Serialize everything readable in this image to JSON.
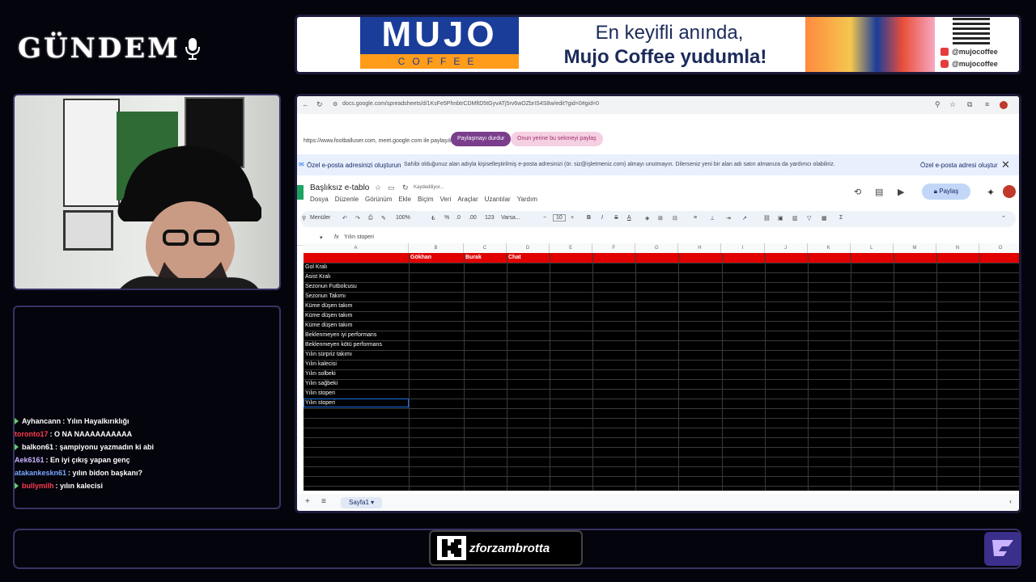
{
  "overlay": {
    "brand": "GÜNDEM",
    "channel_name": "zforzambrotta"
  },
  "ad": {
    "logo_word": "MUJO",
    "logo_sub": "COFFEE",
    "line1": "En keyifli anında,",
    "line2": "Mujo Coffee yudumla!",
    "social_facebook": "@mujocoffee",
    "social_instagram": "@mujocoffee"
  },
  "chat": {
    "messages": [
      {
        "user": "Ayhancann",
        "user_color": "#ffffff",
        "text": ": Yılın Hayalkırıklığı",
        "tri": true
      },
      {
        "user": "toronto17",
        "user_color": "#ff3b4f",
        "text": ": O NA NAAAAAAAAAA",
        "tri": false
      },
      {
        "user": "balkon61",
        "user_color": "#ffffff",
        "text": ": şampiyonu yazmadın ki abi",
        "tri": true
      },
      {
        "user": "Aek6161",
        "user_color": "#c9b3ff",
        "text": ": En iyi çıkış yapan genç",
        "tri": false
      },
      {
        "user": "atakankeskn61",
        "user_color": "#7aa8ff",
        "text": ": yılın bidon başkanı?",
        "tri": false
      },
      {
        "user": "bullymilh",
        "user_color": "#ff3b4f",
        "text": ": yılın kalecisi",
        "tri": true
      }
    ]
  },
  "browser": {
    "url": "docs.google.com/spreadsheets/d/1KsFe5PhnbtrCDMftD5tGyvATj5rv6wOZbrIS4S8w/edit?gid=0#gid=0",
    "share_text": "https://www.footballuser.com, meet.google.com ile paylaşılıyor",
    "stop_sharing": "Paylaşmayı durdur",
    "share_instead": "Onun yerine bu sekmeyi paylaş",
    "info_title": "Özel e-posta adresinizi oluşturun",
    "info_desc": "Sahibi olduğunuz alan adıyla kişiselleştirilmiş e-posta adresinizi (ör. siz@işletmeniz.com) almayı unutmayın. Dilerseniz yeni bir alan adı satın almanıza da yardımcı olabiliriz.",
    "info_action": "Özel e-posta adresi oluştur",
    "info_close": "✕"
  },
  "sheet": {
    "title": "Başlıksız e-tablo",
    "saving": "Kaydediliyor...",
    "menus": [
      "Dosya",
      "Düzenle",
      "Görünüm",
      "Ekle",
      "Biçim",
      "Veri",
      "Araçlar",
      "Uzantılar",
      "Yardım"
    ],
    "share_label": "Paylaş",
    "toolbar": {
      "menus": "Menüler",
      "zoom": "100%",
      "currency": "₺",
      "percent": "%",
      "dec_minus": ".0",
      "dec_plus": ".00",
      "number_format": "123",
      "font": "Varsa...",
      "font_size": "10",
      "bold": "B",
      "italic": "I",
      "strike": "S",
      "text_color": "A"
    },
    "name_box": "",
    "formula_value": "Yılın stoperi",
    "columns": [
      "A",
      "B",
      "C",
      "D",
      "E",
      "F",
      "G",
      "H",
      "I",
      "J",
      "K",
      "L",
      "M",
      "N",
      "O"
    ],
    "header_row": [
      "",
      "Gökhan",
      "Burak",
      "Chat"
    ],
    "rows": [
      "Gol Kralı",
      "Asist Kralı",
      "Sezonun Futbolcusu",
      "Sezonun Takımı",
      "Küme düşen takım",
      "Küme düşen takım",
      "Küme düşen takım",
      "Beklenmeyen iyi performans",
      "Beklenmeyen kötü performans",
      "Yılın sürpriz takımı",
      "Yılın kalecisi",
      "Yılın solbeki",
      "Yılın sağbeki",
      "Yılın stoperi",
      "Yılın stoperi"
    ],
    "sheet_tab": "Sayfa1"
  },
  "colors": {
    "header_red": "#e00000",
    "grid_bg": "#000000",
    "border_purple": "#3a3266",
    "ad_blue": "#1a3d99",
    "ad_orange": "#ff9c1a"
  }
}
